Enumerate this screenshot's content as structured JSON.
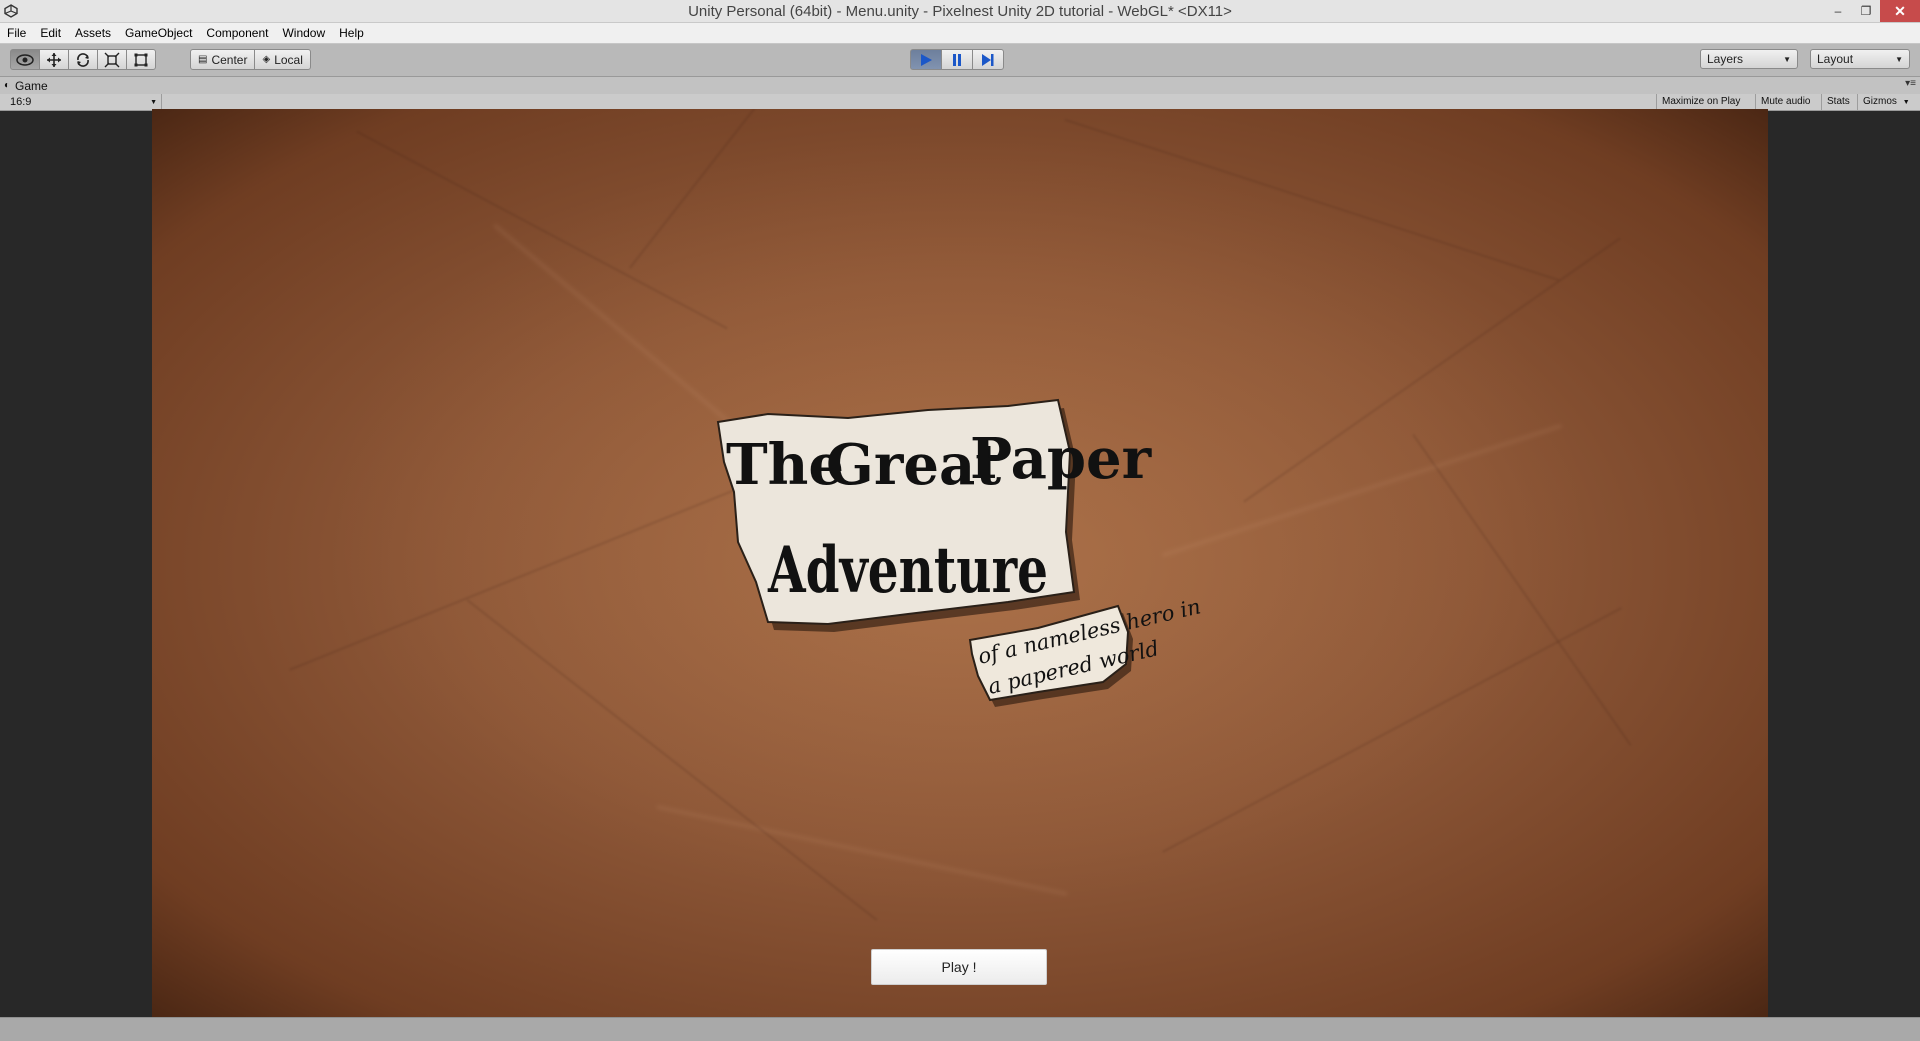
{
  "window": {
    "title": "Unity Personal (64bit) - Menu.unity - Pixelnest Unity 2D tutorial - WebGL* <DX11>",
    "minimize_glyph": "–",
    "maximize_glyph": "❐",
    "close_glyph": "✕"
  },
  "menu": {
    "items": [
      "File",
      "Edit",
      "Assets",
      "GameObject",
      "Component",
      "Window",
      "Help"
    ]
  },
  "toolbar": {
    "tools": [
      "view-tool",
      "move-tool",
      "rotate-tool",
      "scale-tool",
      "rect-tool"
    ],
    "pivot_center": "Center",
    "pivot_local": "Local",
    "layers_label": "Layers",
    "layout_label": "Layout"
  },
  "game_view": {
    "tab_label": "Game",
    "aspect": "16:9",
    "maximize_on_play": "Maximize on Play",
    "mute_audio": "Mute audio",
    "stats": "Stats",
    "gizmos": "Gizmos"
  },
  "scene": {
    "logo_line1_a": "The",
    "logo_line1_b": "Great",
    "logo_line1_c": "Paper",
    "logo_line2": "Adventure",
    "subtitle_line1": "of a nameless hero in",
    "subtitle_line2": "a papered world",
    "play_button": "Play !"
  },
  "colors": {
    "play_active": "#6d7f9c",
    "paper_bg": "#8e5838",
    "close_red": "#c74b4b"
  }
}
